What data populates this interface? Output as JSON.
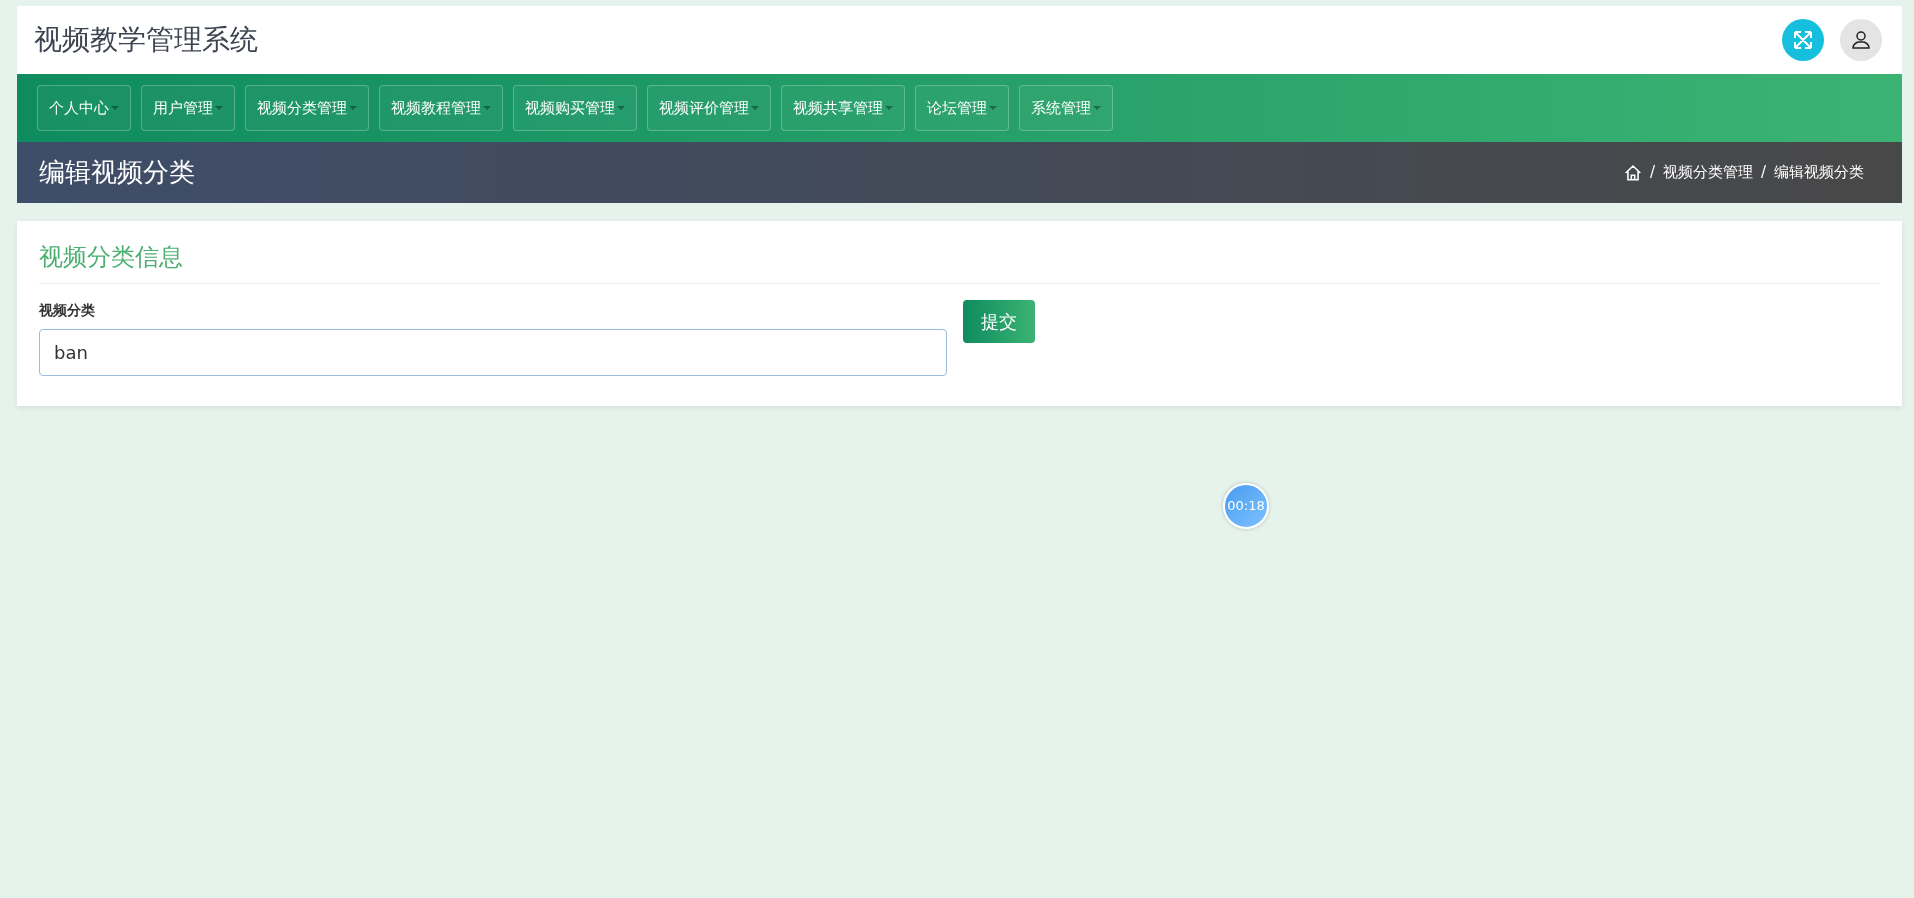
{
  "header": {
    "title": "视频教学管理系统"
  },
  "nav": [
    {
      "label": "个人中心"
    },
    {
      "label": "用户管理"
    },
    {
      "label": "视频分类管理"
    },
    {
      "label": "视频教程管理"
    },
    {
      "label": "视频购买管理"
    },
    {
      "label": "视频评价管理"
    },
    {
      "label": "视频共享管理"
    },
    {
      "label": "论坛管理"
    },
    {
      "label": "系统管理"
    }
  ],
  "page_title": "编辑视频分类",
  "breadcrumb": [
    {
      "separator": "/",
      "label": "视频分类管理"
    },
    {
      "separator": "/",
      "label": "编辑视频分类"
    }
  ],
  "form": {
    "heading": "视频分类信息",
    "label": "视频分类",
    "value": "ban",
    "submit": "提交"
  },
  "timer": "00:18"
}
